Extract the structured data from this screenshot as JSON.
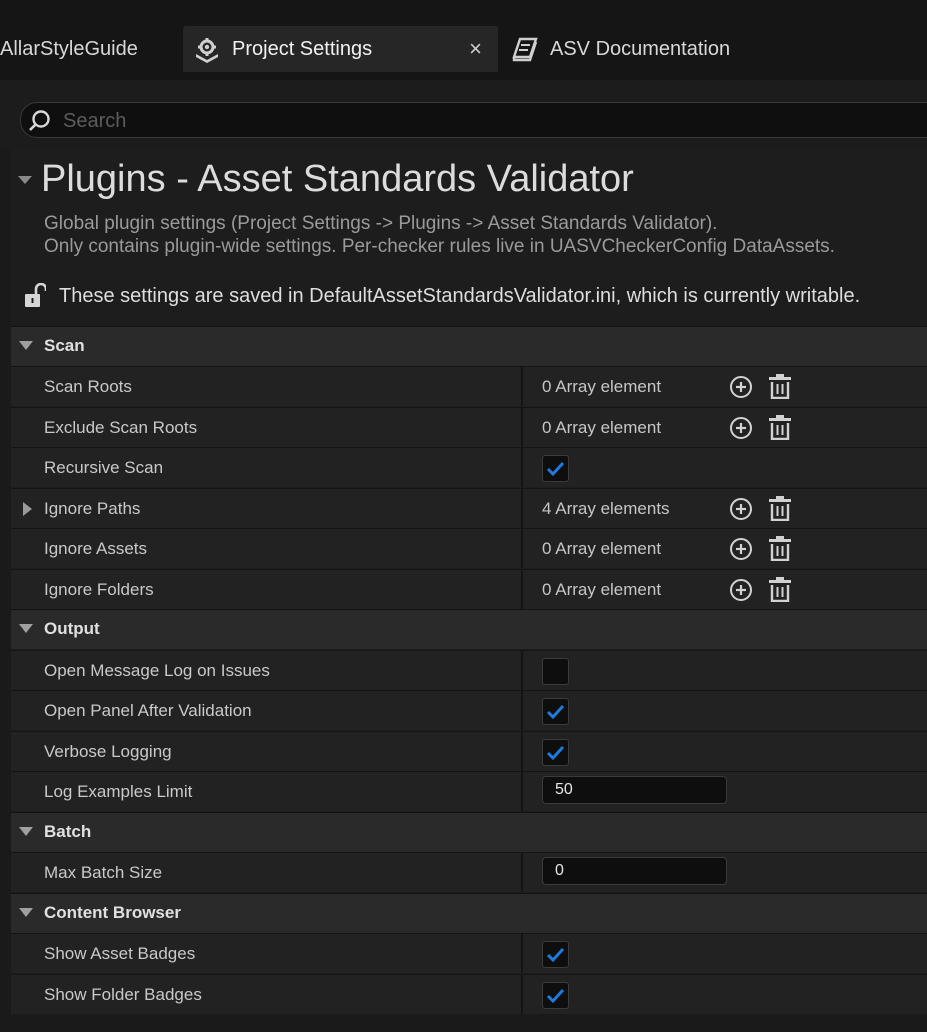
{
  "tabs": [
    {
      "label": "AllarStyleGuide"
    },
    {
      "label": "Project Settings",
      "close": "×"
    },
    {
      "label": "ASV Documentation"
    }
  ],
  "search": {
    "placeholder": "Search"
  },
  "section": {
    "title": "Plugins - Asset Standards Validator",
    "description_line1": "Global plugin settings (Project Settings -> Plugins -> Asset Standards Validator).",
    "description_line2": "Only contains plugin-wide settings. Per-checker rules live in UASVCheckerConfig DataAssets.",
    "notice": "These settings are saved in DefaultAssetStandardsValidator.ini, which is currently writable."
  },
  "categories": {
    "scan": {
      "label": "Scan",
      "scan_roots": {
        "label": "Scan Roots",
        "value": "0 Array element"
      },
      "exclude_scan_roots": {
        "label": "Exclude Scan Roots",
        "value": "0 Array element"
      },
      "recursive_scan": {
        "label": "Recursive Scan",
        "checked": true
      },
      "ignore_paths": {
        "label": "Ignore Paths",
        "value": "4 Array elements"
      },
      "ignore_assets": {
        "label": "Ignore Assets",
        "value": "0 Array element"
      },
      "ignore_folders": {
        "label": "Ignore Folders",
        "value": "0 Array element"
      }
    },
    "output": {
      "label": "Output",
      "open_message_log": {
        "label": "Open Message Log on Issues",
        "checked": false
      },
      "open_panel_after_validation": {
        "label": "Open Panel After Validation",
        "checked": true
      },
      "verbose_logging": {
        "label": "Verbose Logging",
        "checked": true
      },
      "log_examples_limit": {
        "label": "Log Examples Limit",
        "value": "50"
      }
    },
    "batch": {
      "label": "Batch",
      "max_batch_size": {
        "label": "Max Batch Size",
        "value": "0"
      }
    },
    "content_browser": {
      "label": "Content Browser",
      "show_asset_badges": {
        "label": "Show Asset Badges",
        "checked": true
      },
      "show_folder_badges": {
        "label": "Show Folder Badges",
        "checked": true
      }
    }
  },
  "colors": {
    "accent_check": "#1f7ae0",
    "background": "#1a1a1a",
    "row": "#222222",
    "category": "#2a2a2a"
  },
  "icons": {
    "settings_tab": "gear-icon",
    "docs_tab": "book-icon",
    "search": "search-icon",
    "lock": "unlocked-lock-icon",
    "add": "add-circle-icon",
    "delete": "trash-icon"
  }
}
